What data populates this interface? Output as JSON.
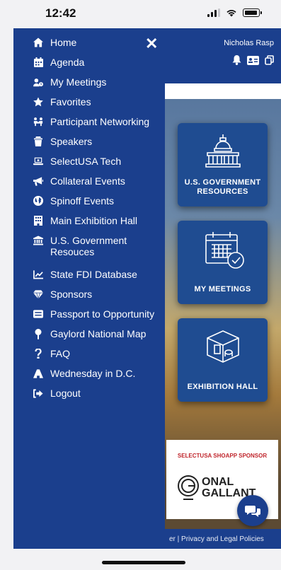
{
  "status_bar": {
    "time": "12:42"
  },
  "header": {
    "user_name": "Nicholas Rasp",
    "close_symbol": "✕"
  },
  "menu": {
    "items": [
      {
        "label": "Home",
        "icon": "home-icon"
      },
      {
        "label": "Agenda",
        "icon": "calendar-icon"
      },
      {
        "label": "My Meetings",
        "icon": "meeting-icon"
      },
      {
        "label": "Favorites",
        "icon": "star-icon"
      },
      {
        "label": "Participant Networking",
        "icon": "networking-icon"
      },
      {
        "label": "Speakers",
        "icon": "microphone-icon"
      },
      {
        "label": "SelectUSA Tech",
        "icon": "laptop-icon"
      },
      {
        "label": "Collateral Events",
        "icon": "megaphone-icon"
      },
      {
        "label": "Spinoff Events",
        "icon": "globe-icon"
      },
      {
        "label": "Main Exhibition Hall",
        "icon": "building-icon"
      },
      {
        "label": "U.S. Government Resouces",
        "icon": "government-icon"
      },
      {
        "label": "State FDI Database",
        "icon": "chart-icon"
      },
      {
        "label": "Sponsors",
        "icon": "gem-icon"
      },
      {
        "label": "Passport to Opportunity",
        "icon": "passport-icon"
      },
      {
        "label": "Gaylord National Map",
        "icon": "map-pin-icon"
      },
      {
        "label": "FAQ",
        "icon": "question-icon"
      },
      {
        "label": "Wednesday in D.C.",
        "icon": "monument-icon"
      },
      {
        "label": "Logout",
        "icon": "logout-icon"
      }
    ]
  },
  "tiles": {
    "gov": "U.S. GOVERNMENT RESOURCES",
    "meetings": "MY MEETINGS",
    "hall": "EXHIBITION HALL"
  },
  "sponsor": {
    "label": "SELECTUSA SHOAPP SPONSOR",
    "name_line1": "ONAL",
    "name_line2": "GALLANT"
  },
  "footer": {
    "text": "er | Privacy and Legal Policies"
  },
  "colors": {
    "primary": "#1b3f8d",
    "tile": "#1f4c91",
    "sponsor_red": "#c0262d"
  }
}
